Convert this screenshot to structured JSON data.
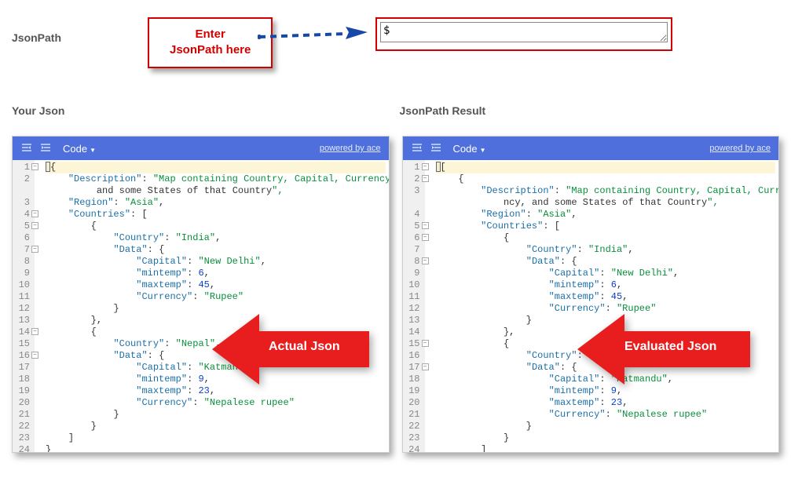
{
  "labels": {
    "jsonpath": "JsonPath",
    "your_json": "Your Json",
    "result": "JsonPath Result"
  },
  "callout": {
    "line1": "Enter",
    "line2": "JsonPath here"
  },
  "input": {
    "value": "$"
  },
  "toolbar": {
    "code_label": "Code",
    "powered": "powered by ace"
  },
  "arrows": {
    "left_label": "Actual Json",
    "right_label": "Evaluated Json"
  },
  "left_pane": {
    "lines": [
      {
        "n": 1,
        "txt": "{",
        "fold": true,
        "hl": true,
        "cursor": true
      },
      {
        "n": 2,
        "txt": "    \"Description\": \"Map containing Country, Capital, Currency, and some States of that Country\",",
        "wrap": true
      },
      {
        "n": 3,
        "txt": "    \"Region\": \"Asia\","
      },
      {
        "n": 4,
        "txt": "    \"Countries\": [",
        "fold": true
      },
      {
        "n": 5,
        "txt": "        {",
        "fold": true
      },
      {
        "n": 6,
        "txt": "            \"Country\": \"India\","
      },
      {
        "n": 7,
        "txt": "            \"Data\": {",
        "fold": true
      },
      {
        "n": 8,
        "txt": "                \"Capital\": \"New Delhi\","
      },
      {
        "n": 9,
        "txt": "                \"mintemp\": 6,",
        "num": true
      },
      {
        "n": 10,
        "txt": "                \"maxtemp\": 45,",
        "num": true
      },
      {
        "n": 11,
        "txt": "                \"Currency\": \"Rupee\""
      },
      {
        "n": 12,
        "txt": "            }"
      },
      {
        "n": 13,
        "txt": "        },"
      },
      {
        "n": 14,
        "txt": "        {",
        "fold": true
      },
      {
        "n": 15,
        "txt": "            \"Country\": \"Nepal\","
      },
      {
        "n": 16,
        "txt": "            \"Data\": {",
        "fold": true
      },
      {
        "n": 17,
        "txt": "                \"Capital\": \"Katmandu\","
      },
      {
        "n": 18,
        "txt": "                \"mintemp\": 9,",
        "num": true
      },
      {
        "n": 19,
        "txt": "                \"maxtemp\": 23,",
        "num": true
      },
      {
        "n": 20,
        "txt": "                \"Currency\": \"Nepalese rupee\""
      },
      {
        "n": 21,
        "txt": "            }"
      },
      {
        "n": 22,
        "txt": "        }"
      },
      {
        "n": 23,
        "txt": "    ]"
      },
      {
        "n": 24,
        "txt": "}"
      }
    ]
  },
  "right_pane": {
    "lines": [
      {
        "n": 1,
        "txt": "[",
        "fold": true,
        "hl": true,
        "cursor": true
      },
      {
        "n": 2,
        "txt": "    {",
        "fold": true
      },
      {
        "n": 3,
        "txt": "        \"Description\": \"Map containing Country, Capital, Currency, and some States of that Country\",",
        "wrap": true
      },
      {
        "n": 4,
        "txt": "        \"Region\": \"Asia\","
      },
      {
        "n": 5,
        "txt": "        \"Countries\": [",
        "fold": true
      },
      {
        "n": 6,
        "txt": "            {",
        "fold": true
      },
      {
        "n": 7,
        "txt": "                \"Country\": \"India\","
      },
      {
        "n": 8,
        "txt": "                \"Data\": {",
        "fold": true
      },
      {
        "n": 9,
        "txt": "                    \"Capital\": \"New Delhi\","
      },
      {
        "n": 10,
        "txt": "                    \"mintemp\": 6,",
        "num": true
      },
      {
        "n": 11,
        "txt": "                    \"maxtemp\": 45,",
        "num": true
      },
      {
        "n": 12,
        "txt": "                    \"Currency\": \"Rupee\""
      },
      {
        "n": 13,
        "txt": "                }"
      },
      {
        "n": 14,
        "txt": "            },"
      },
      {
        "n": 15,
        "txt": "            {",
        "fold": true
      },
      {
        "n": 16,
        "txt": "                \"Country\": \"Nepal\","
      },
      {
        "n": 17,
        "txt": "                \"Data\": {",
        "fold": true
      },
      {
        "n": 18,
        "txt": "                    \"Capital\": \"Katmandu\","
      },
      {
        "n": 19,
        "txt": "                    \"mintemp\": 9,",
        "num": true
      },
      {
        "n": 20,
        "txt": "                    \"maxtemp\": 23,",
        "num": true
      },
      {
        "n": 21,
        "txt": "                    \"Currency\": \"Nepalese rupee\""
      },
      {
        "n": 22,
        "txt": "                }"
      },
      {
        "n": 23,
        "txt": "            }"
      },
      {
        "n": 24,
        "txt": "        ]"
      },
      {
        "n": 25,
        "txt": "    }"
      },
      {
        "n": 26,
        "txt": "]"
      }
    ]
  }
}
